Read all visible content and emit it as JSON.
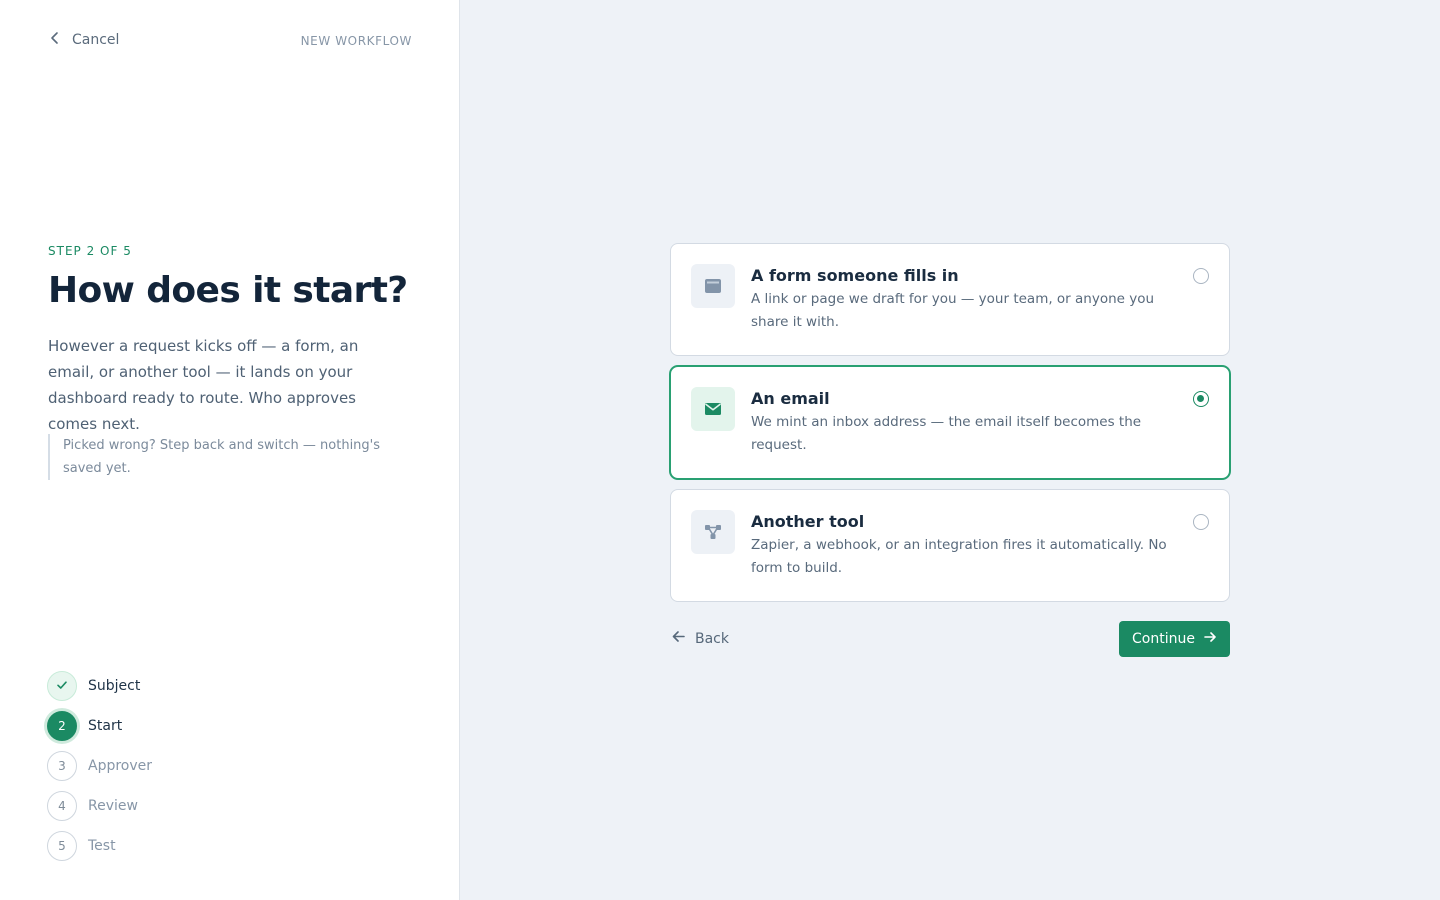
{
  "header": {
    "cancel_label": "Cancel",
    "context_label": "NEW WORKFLOW"
  },
  "intro": {
    "step_label": "STEP 2 OF 5",
    "title": "How does it start?",
    "description": "However a request kicks off — a form, an email, or another tool — it lands on your dashboard ready to route. Who approves comes next.",
    "note": "Picked wrong? Step back and switch — nothing's saved yet."
  },
  "steps": [
    {
      "number": "1",
      "label": "Subject",
      "state": "done"
    },
    {
      "number": "2",
      "label": "Start",
      "state": "current"
    },
    {
      "number": "3",
      "label": "Approver",
      "state": "upcoming"
    },
    {
      "number": "4",
      "label": "Review",
      "state": "upcoming"
    },
    {
      "number": "5",
      "label": "Test",
      "state": "upcoming"
    }
  ],
  "options": [
    {
      "icon": "form-icon",
      "title": "A form someone fills in",
      "description": "A link or page we draft for you — your team, or anyone you share it with.",
      "selected": false
    },
    {
      "icon": "envelope-icon",
      "title": "An email",
      "description": "We mint an inbox address — the email itself becomes the request.",
      "selected": true
    },
    {
      "icon": "integration-icon",
      "title": "Another tool",
      "description": "Zapier, a webhook, or an integration fires it automatically. No form to build.",
      "selected": false
    }
  ],
  "actions": {
    "back_label": "Back",
    "continue_label": "Continue"
  },
  "colors": {
    "accent": "#1b8a63",
    "page_background": "#eef2f7",
    "panel_background": "#ffffff"
  }
}
